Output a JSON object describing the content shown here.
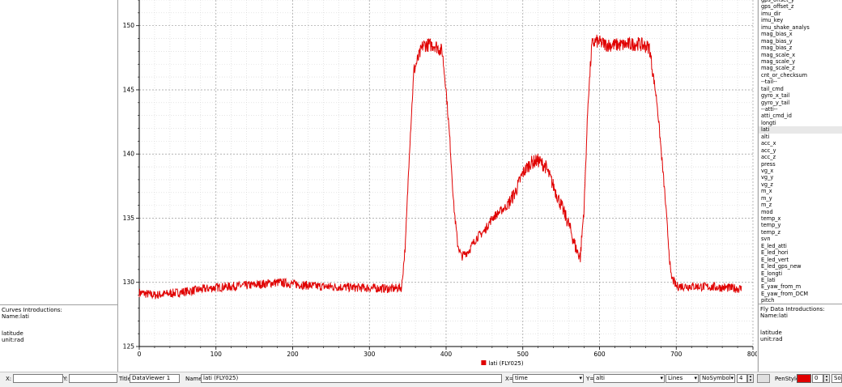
{
  "left_panel": {
    "intro_title": "Curves Introductions:",
    "intro_name": "Name:lati",
    "intro_desc": "latitude",
    "intro_unit": "unit:rad"
  },
  "right_panel": {
    "variables": [
      "gps_offset_y",
      "gps_offset_z",
      "imu_dir",
      "imu_key",
      "imu_shake_analys",
      "mag_bias_x",
      "mag_bias_y",
      "mag_bias_z",
      "mag_scale_x",
      "mag_scale_y",
      "mag_scale_z",
      "cnt_or_checksum",
      "--tail--",
      "tail_cmd",
      "gyro_x_tail",
      "gyro_y_tail",
      "--atti--",
      "atti_cmd_id",
      "longti",
      "lati",
      "alti",
      "acc_x",
      "acc_y",
      "acc_z",
      "press",
      "vg_x",
      "vg_y",
      "vg_z",
      "m_x",
      "m_y",
      "m_z",
      "mod",
      "temp_x",
      "temp_y",
      "temp_z",
      "svn",
      "E_led_atti",
      "E_led_hori",
      "E_led_vert",
      "E_led_gps_new",
      "E_longti",
      "E_lati",
      "E_yaw_from_m",
      "E_yaw_from_DCM",
      "pitch"
    ],
    "selected_variable": "lati",
    "intro_title": "Fly Data Introductions:",
    "intro_name": "Name:lati",
    "intro_desc": "latitude",
    "intro_unit": "unit:rad"
  },
  "bottom_bar": {
    "x_label": "X:",
    "y_label": "Y:",
    "title_label": "Title:",
    "title_value": "DataViewer 1",
    "name_label": "Name=",
    "name_value": "lati (FLY025)",
    "xaxis_label": "X=",
    "xaxis_value": "time",
    "yaxis_label": "Y=",
    "yaxis_value": "alti",
    "style_value": "Lines",
    "symbol_value": "NoSymbol",
    "size_value": "4",
    "penstyle_label": "PenStyle:",
    "pen_color": "#e00000",
    "pen_width": "0",
    "line_style": "Solid"
  },
  "chart_data": {
    "type": "line",
    "title": "",
    "xlabel": "",
    "ylabel": "",
    "xlim": [
      0,
      800
    ],
    "ylim": [
      125,
      152
    ],
    "x_ticks": [
      "0",
      "100",
      "200",
      "300",
      "400",
      "500",
      "600",
      "700",
      "800"
    ],
    "y_ticks": [
      "125",
      "130",
      "135",
      "140",
      "145",
      "150"
    ],
    "grid": true,
    "legend_position": "bottom-center",
    "series": [
      {
        "name": "lati (FLY025)",
        "color": "#e00000",
        "x": [
          0,
          20,
          50,
          100,
          150,
          180,
          230,
          280,
          330,
          342,
          347,
          352,
          358,
          370,
          385,
          395,
          400,
          405,
          410,
          415,
          420,
          430,
          440,
          450,
          460,
          470,
          480,
          490,
          500,
          510,
          520,
          530,
          540,
          550,
          560,
          570,
          575,
          580,
          585,
          590,
          595,
          600,
          610,
          630,
          650,
          665,
          675,
          685,
          693,
          700,
          720,
          760,
          785
        ],
        "y": [
          129.2,
          129,
          129.2,
          129.6,
          129.8,
          130,
          129.7,
          129.6,
          129.5,
          129.6,
          133,
          140,
          146.5,
          148.5,
          148.5,
          148,
          145,
          141,
          136,
          133,
          132,
          132.5,
          133.5,
          134,
          135,
          135.5,
          136,
          137,
          138.5,
          139.3,
          139.5,
          139,
          137.5,
          136,
          134.5,
          132.5,
          132,
          136,
          144,
          148.5,
          148.8,
          148.7,
          148.5,
          148.5,
          148.6,
          148.3,
          144,
          137,
          130.5,
          129.7,
          129.7,
          129.6,
          129.5
        ]
      }
    ]
  }
}
